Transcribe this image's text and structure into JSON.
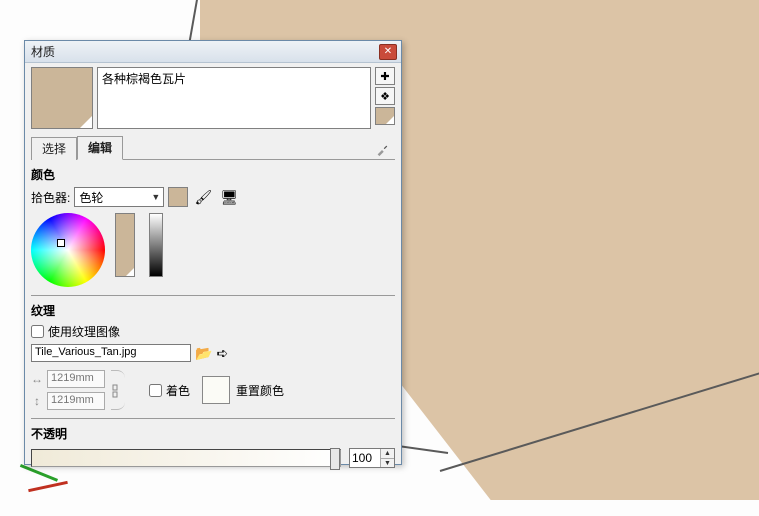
{
  "window": {
    "title": "材质"
  },
  "material": {
    "name": "各种棕褐色瓦片",
    "preview_color": "#cbb699"
  },
  "tabs": {
    "select": "选择",
    "edit": "编辑"
  },
  "color": {
    "section": "颜色",
    "picker_label": "拾色器:",
    "picker_value": "色轮"
  },
  "texture": {
    "section": "纹理",
    "use_image": "使用纹理图像",
    "filename": "Tile_Various_Tan.jpg",
    "width": "1219mm",
    "height": "1219mm",
    "tint": "着色",
    "reset": "重置颜色"
  },
  "opacity": {
    "section": "不透明",
    "value": "100"
  }
}
